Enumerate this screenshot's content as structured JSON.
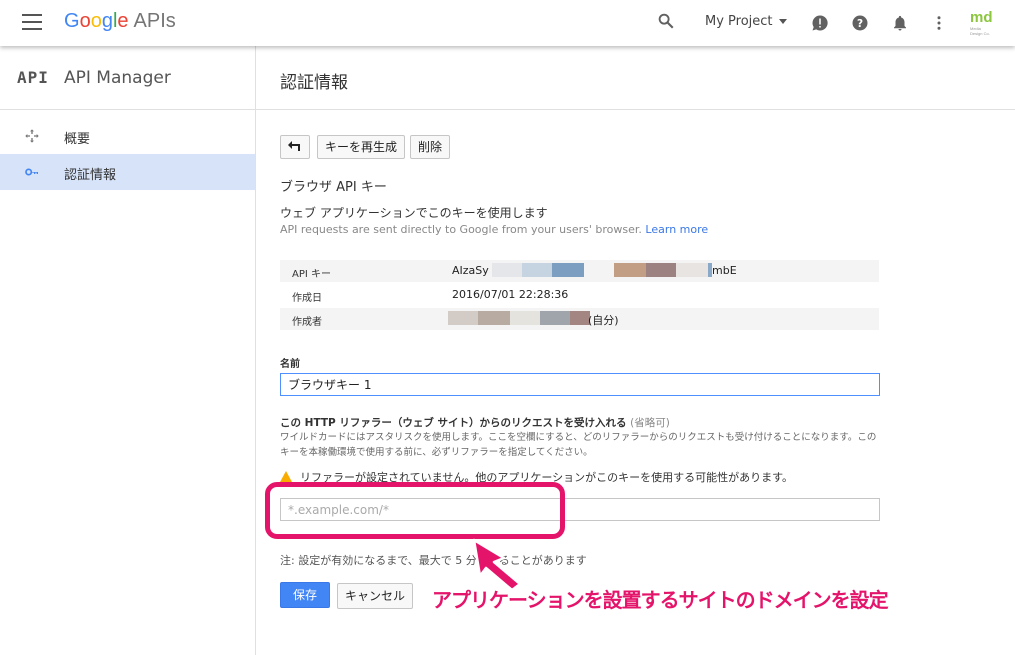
{
  "topbar": {
    "logo_google": [
      "G",
      "o",
      "o",
      "g",
      "l",
      "e"
    ],
    "logo_apis": "APIs",
    "project_name": "My Project"
  },
  "sidebar": {
    "api_badge": "API",
    "title": "API Manager",
    "items": [
      {
        "label": "概要",
        "icon": "overview-icon"
      },
      {
        "label": "認証情報",
        "icon": "key-icon",
        "active": true
      }
    ]
  },
  "page": {
    "title": "認証情報"
  },
  "actions": {
    "back_label": "↩",
    "regenerate_label": "キーを再生成",
    "delete_label": "削除"
  },
  "key": {
    "type_title": "ブラウザ API キー",
    "usage_title": "ウェブ アプリケーションでこのキーを使用します",
    "usage_desc": "API requests are sent directly to Google from your users' browser.",
    "learn_more": "Learn more",
    "rows": [
      {
        "key": "API キー",
        "value_prefix": "AIzaSy",
        "value_suffix": "mbE"
      },
      {
        "key": "作成日",
        "value": "2016/07/01 22:28:36"
      },
      {
        "key": "作成者",
        "value_suffix": "(自分)"
      }
    ]
  },
  "form": {
    "name_label": "名前",
    "name_value": "ブラウザキー 1",
    "referrer_label": "この HTTP リファラー（ウェブ サイト）からのリクエストを受け入れる",
    "referrer_optional": "(省略可)",
    "referrer_help": "ワイルドカードにはアスタリスクを使用します。ここを空欄にすると、どのリファラーからのリクエストも受け付けることになります。このキーを本稼働環境で使用する前に、必ずリファラーを指定してください。",
    "warning": "リファラーが設定されていません。他のアプリケーションがこのキーを使用する可能性があります。",
    "referrer_placeholder": "*.example.com/*",
    "note": "注: 設定が有効になるまで、最大で 5 分かかることがあります",
    "save_label": "保存",
    "cancel_label": "キャンセル"
  },
  "annotation": {
    "text": "アプリケーションを設置するサイトのドメインを設定",
    "color": "#e5146b"
  }
}
